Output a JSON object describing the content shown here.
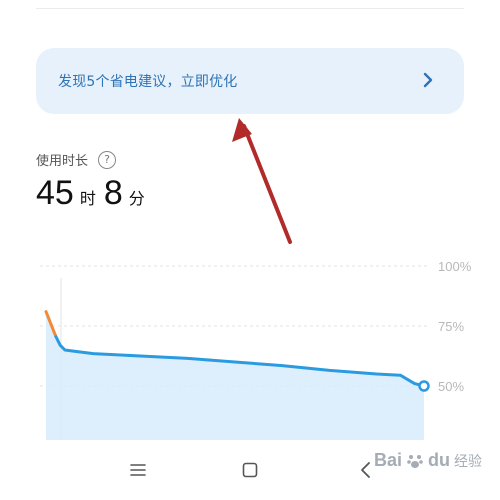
{
  "suggestion": {
    "text": "发现5个省电建议，立即优化",
    "chevron_icon": "chevron-right-icon"
  },
  "usage": {
    "label": "使用时长",
    "help_glyph": "?",
    "hours": "45",
    "hours_unit": "时",
    "minutes": "8",
    "minutes_unit": "分"
  },
  "chart_data": {
    "type": "area",
    "y_ticks": [
      "100%",
      "75%",
      "50%"
    ],
    "ylim": [
      40,
      100
    ],
    "x": [
      0,
      1,
      2,
      3,
      4,
      6,
      10,
      20,
      30,
      40,
      50,
      60,
      70,
      75,
      78,
      80
    ],
    "values": [
      81,
      76,
      71,
      67,
      65,
      64.5,
      63.5,
      62.5,
      61.5,
      60,
      58.5,
      56.5,
      55,
      54.5,
      51,
      50
    ],
    "grid": true,
    "colors": {
      "line": "#2a9be0",
      "area": "#d7ecfb",
      "spike": "#f08a3a",
      "grid": "#e3e3e3"
    }
  },
  "nav": {
    "menu_icon": "menu-icon",
    "home_icon": "home-icon",
    "back_icon": "back-icon"
  },
  "watermark": {
    "brand": "Bai",
    "brand2": "du",
    "cn": "经验"
  },
  "colors": {
    "card_bg": "#e6f1fb",
    "card_text": "#2f73b5",
    "annotation_arrow": "#b22b2b"
  }
}
